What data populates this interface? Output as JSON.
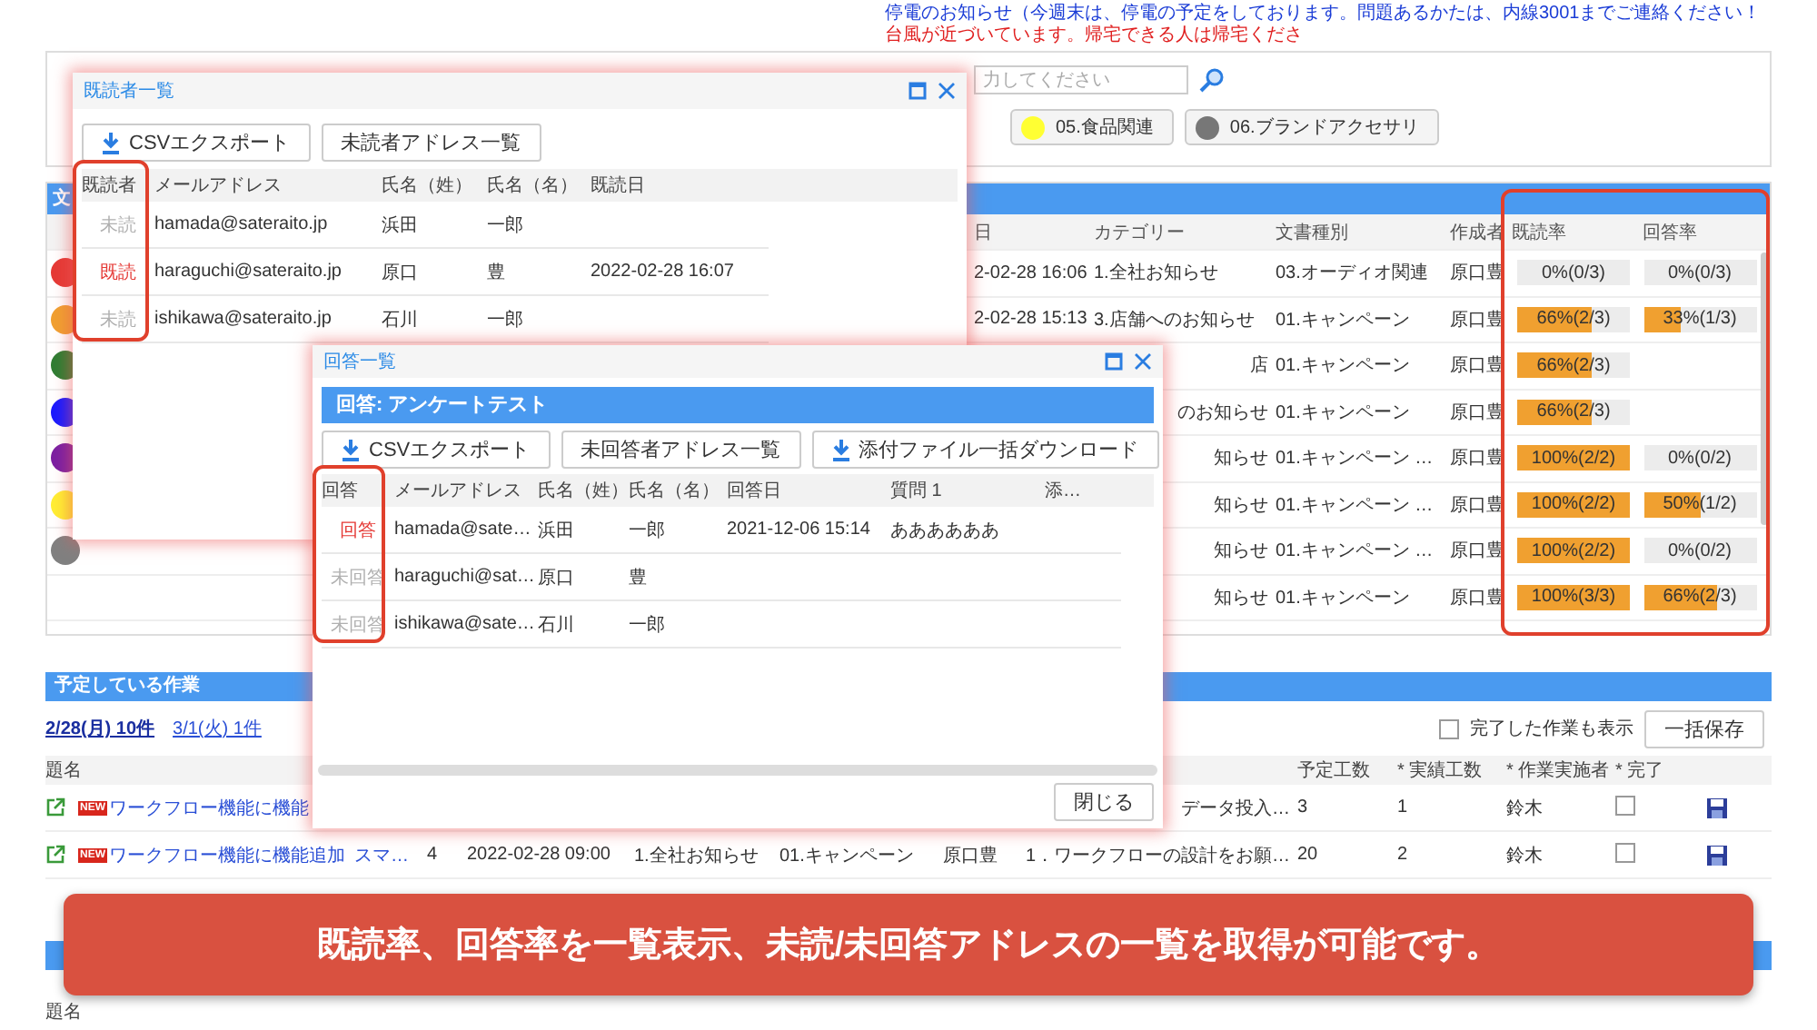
{
  "notices": [
    {
      "text": "停電のお知らせ（今週末は、停電の予定をしております。問題あるかたは、内線3001までご連絡ください！",
      "color": "#1a3cd6"
    },
    {
      "text": "台風が近づいています。帰宅できる人は帰宅くださ",
      "color": "#e02020"
    }
  ],
  "header": {
    "search": {
      "placeholder": "力してください"
    },
    "categories": [
      {
        "label": "05.食品関連",
        "color": "#ffff33"
      },
      {
        "label": "06.ブランドアクセサリ",
        "color": "#777777"
      }
    ]
  },
  "documents": {
    "title": "文",
    "columns": [
      "日",
      "カテゴリー",
      "文書種別",
      "作成者",
      "既読率",
      "回答率"
    ],
    "rows": [
      {
        "color": "#e53935",
        "date": "2-02-28 16:06",
        "category": "1.全社お知らせ",
        "type": "03.オーディオ関連",
        "author": "原口豊",
        "read": {
          "text": "0%(0/3)",
          "level": 0
        },
        "answer": {
          "text": "0%(0/3)",
          "level": 0
        }
      },
      {
        "color": "#f0a030",
        "date": "2-02-28 15:13",
        "category": "3.店舗へのお知らせ",
        "type": "01.キャンペーン",
        "author": "原口豊",
        "read": {
          "text": "66%(2/3)",
          "level": 0.66
        },
        "answer": {
          "text": "33%(1/3)",
          "level": 0.33
        }
      },
      {
        "color": "#2e7d32",
        "category": "店",
        "type": "01.キャンペーン",
        "author": "原口豊",
        "read": {
          "text": "66%(2/3)",
          "level": 0.66
        }
      },
      {
        "color": "#1a1aff",
        "category": "のお知らせ",
        "type": "01.キャンペーン",
        "author": "原口豊",
        "read": {
          "text": "66%(2/3)",
          "level": 0.66
        }
      },
      {
        "color": "#7b1fa2",
        "category": "知らせ",
        "type": "01.キャンペーン …",
        "author": "原口豊",
        "read": {
          "text": "100%(2/2)",
          "level": 1
        },
        "answer": {
          "text": "0%(0/2)",
          "level": 0
        }
      },
      {
        "color": "#ffee33",
        "category": "知らせ",
        "type": "01.キャンペーン …",
        "author": "原口豊",
        "read": {
          "text": "100%(2/2)",
          "level": 1
        },
        "answer": {
          "text": "50%(1/2)",
          "level": 0.5
        }
      },
      {
        "color": "#808080",
        "category": "知らせ",
        "type": "01.キャンペーン …",
        "author": "原口豊",
        "read": {
          "text": "100%(2/2)",
          "level": 1
        },
        "answer": {
          "text": "0%(0/2)",
          "level": 0
        }
      },
      {
        "category": "知らせ",
        "type": "01.キャンペーン",
        "author": "原口豊",
        "read": {
          "text": "100%(3/3)",
          "level": 1
        },
        "answer": {
          "text": "66%(2/3)",
          "level": 0.66
        }
      }
    ]
  },
  "tasks": {
    "title": "予定している作業",
    "days": [
      {
        "label": "2/28(月) 10件",
        "selected": true
      },
      {
        "label": "3/1(火) 1件",
        "selected": false
      }
    ],
    "show_done": {
      "label": "完了した作業も表示",
      "checked": false
    },
    "save_all": "一括保存",
    "columns": [
      "題名",
      "予定工数",
      "* 実績工数",
      "* 作業実施者",
      "* 完了"
    ],
    "rows": [
      {
        "badge": "NEW",
        "title": "ワークフロー機能に機能",
        "desc": "データ投入…",
        "planned": "3",
        "actual": "1",
        "assignee": "鈴木",
        "done": false
      },
      {
        "badge": "NEW",
        "title": "ワークフロー機能に機能追加",
        "col2": "スマ…",
        "col3": "4",
        "date": "2022-02-28 09:00",
        "category": "1.全社お知らせ",
        "type": "01.キャンペーン",
        "author": "原口豊",
        "desc": "1．ワークフローの設計をお願…",
        "planned": "20",
        "actual": "2",
        "assignee": "鈴木",
        "done": false
      }
    ]
  },
  "lower": {
    "columns": [
      "題名"
    ]
  },
  "reader_dialog": {
    "title": "既読者一覧",
    "buttons": [
      {
        "label": "CSVエクスポート",
        "kind": "download"
      },
      {
        "label": "未読者アドレス一覧",
        "kind": "plain"
      }
    ],
    "columns": [
      "既読者",
      "メールアドレス",
      "氏名（姓）",
      "氏名（名）",
      "既読日"
    ],
    "rows": [
      {
        "status": "未読",
        "read": false,
        "email": "hamada@sateraito.jp",
        "last": "浜田",
        "first": "一郎"
      },
      {
        "status": "既読",
        "read": true,
        "email": "haraguchi@sateraito.jp",
        "last": "原口",
        "first": "豊",
        "date": "2022-02-28 16:07"
      },
      {
        "status": "未読",
        "read": false,
        "email": "ishikawa@sateraito.jp",
        "last": "石川",
        "first": "一郎"
      }
    ]
  },
  "answer_dialog": {
    "title": "回答一覧",
    "subtitle": "回答: アンケートテスト",
    "buttons": [
      {
        "label": "CSVエクスポート",
        "kind": "download"
      },
      {
        "label": "未回答者アドレス一覧",
        "kind": "plain"
      },
      {
        "label": "添付ファイル一括ダウンロード",
        "kind": "download"
      }
    ],
    "columns": [
      "回答",
      "メールアドレス",
      "氏名（姓）",
      "氏名（名）",
      "回答日",
      "質問 1",
      "添…"
    ],
    "rows": [
      {
        "status": "回答",
        "answered": true,
        "email": "hamada@sate…",
        "last": "浜田",
        "first": "一郎",
        "date": "2021-12-06 15:14",
        "q1": "ああああああ"
      },
      {
        "status": "未回答",
        "answered": false,
        "email": "haraguchi@sat…",
        "last": "原口",
        "first": "豊"
      },
      {
        "status": "未回答",
        "answered": false,
        "email": "ishikawa@sate…",
        "last": "石川",
        "first": "一郎"
      }
    ],
    "close": "閉じる"
  },
  "banner": "既読率、回答率を一覧表示、未読/未回答アドレスの一覧を取得が可能です。"
}
